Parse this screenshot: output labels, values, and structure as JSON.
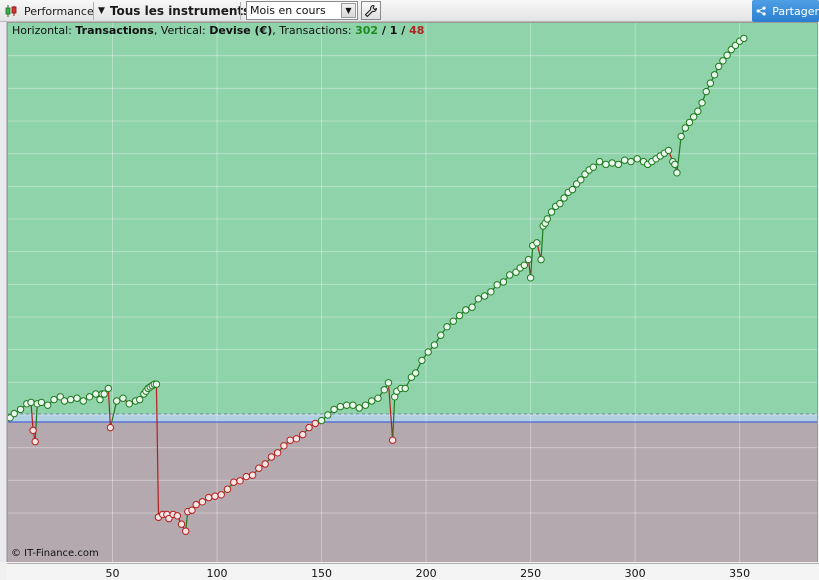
{
  "toolbar": {
    "performance_label": "Performance",
    "instruments_label": "Tous les instruments",
    "period_select": "Mois en cours",
    "share_label": "Partager"
  },
  "info_bar": {
    "horizontal_prefix": "Horizontal: ",
    "horizontal_value": "Transactions",
    "vertical_prefix": ", Vertical: ",
    "vertical_value": "Devise (€)",
    "transactions_prefix": ", Transactions: ",
    "wins": "302",
    "slash1": " / ",
    "neutral": "1",
    "slash2": " / ",
    "losses": "48"
  },
  "copyright": "© IT-Finance.com",
  "colors": {
    "profit_zone": "#8fd3aa",
    "loss_zone": "#b4a9ae",
    "baseline": "#4a63d6",
    "win_line": "#1f7a1f",
    "loss_line": "#b81e1e"
  },
  "chart_data": {
    "type": "line",
    "xlabel": "",
    "ylabel": "",
    "x_ticks": [
      50,
      100,
      150,
      200,
      250,
      300,
      350
    ],
    "xlim": [
      0,
      387
    ],
    "ylim": [
      -1.0,
      2.85
    ],
    "baseline": 0,
    "series": [
      {
        "x": [
          1,
          3,
          6,
          9,
          11,
          12,
          13,
          14,
          16,
          19,
          22,
          25,
          27,
          30,
          33,
          36,
          39,
          42,
          44,
          45,
          46,
          48,
          49,
          52,
          55,
          58,
          61,
          63,
          65,
          66,
          67,
          68,
          69,
          70,
          71,
          72,
          72,
          74,
          76,
          77,
          79,
          81,
          83,
          85,
          86,
          88,
          90,
          93,
          96,
          99,
          102,
          105,
          108,
          111,
          114,
          117,
          120,
          123,
          126,
          129,
          132,
          135,
          138,
          141,
          144,
          147,
          150,
          153,
          156,
          159,
          162,
          165,
          168,
          171,
          174,
          177,
          180,
          182,
          184,
          185,
          186,
          188,
          190,
          193,
          195,
          198,
          201,
          204,
          207,
          210,
          213,
          216,
          219,
          222,
          225,
          228,
          231,
          234,
          237,
          240,
          243,
          245,
          247,
          249,
          250,
          251,
          253,
          255,
          256,
          257,
          258,
          260,
          262,
          264,
          266,
          268,
          270,
          272,
          274,
          276,
          278,
          280,
          283,
          286,
          289,
          292,
          295,
          298,
          301,
          304,
          306,
          308,
          310,
          312,
          314,
          316,
          318,
          319,
          320,
          322,
          324,
          326,
          328,
          330,
          332,
          334,
          336,
          338,
          340,
          342,
          344,
          346,
          348,
          350,
          352
        ],
        "y": [
          0.03,
          0.06,
          0.09,
          0.13,
          0.14,
          -0.06,
          -0.14,
          0.13,
          0.14,
          0.12,
          0.16,
          0.18,
          0.15,
          0.16,
          0.17,
          0.15,
          0.18,
          0.2,
          0.16,
          0.2,
          0.2,
          0.24,
          -0.04,
          0.15,
          0.17,
          0.13,
          0.15,
          0.16,
          0.2,
          0.22,
          0.24,
          0.25,
          0.26,
          0.27,
          0.27,
          -0.68,
          -0.68,
          -0.66,
          -0.66,
          -0.69,
          -0.66,
          -0.67,
          -0.73,
          -0.78,
          -0.64,
          -0.63,
          -0.59,
          -0.57,
          -0.54,
          -0.53,
          -0.52,
          -0.48,
          -0.43,
          -0.42,
          -0.39,
          -0.38,
          -0.33,
          -0.3,
          -0.25,
          -0.22,
          -0.17,
          -0.13,
          -0.12,
          -0.09,
          -0.04,
          -0.01,
          0.01,
          0.05,
          0.09,
          0.11,
          0.12,
          0.12,
          0.1,
          0.12,
          0.15,
          0.17,
          0.23,
          0.28,
          -0.13,
          0.18,
          0.22,
          0.24,
          0.24,
          0.32,
          0.35,
          0.44,
          0.5,
          0.55,
          0.62,
          0.68,
          0.72,
          0.76,
          0.8,
          0.82,
          0.88,
          0.9,
          0.93,
          0.98,
          1.0,
          1.05,
          1.07,
          1.1,
          1.12,
          1.16,
          1.03,
          1.26,
          1.28,
          1.16,
          1.4,
          1.42,
          1.45,
          1.5,
          1.54,
          1.56,
          1.6,
          1.64,
          1.66,
          1.7,
          1.73,
          1.77,
          1.8,
          1.82,
          1.86,
          1.84,
          1.85,
          1.84,
          1.87,
          1.86,
          1.88,
          1.86,
          1.84,
          1.86,
          1.88,
          1.9,
          1.92,
          1.94,
          1.86,
          1.84,
          1.78,
          2.04,
          2.1,
          2.14,
          2.18,
          2.22,
          2.28,
          2.36,
          2.42,
          2.48,
          2.54,
          2.58,
          2.62,
          2.66,
          2.69,
          2.72,
          2.74
        ]
      }
    ]
  }
}
